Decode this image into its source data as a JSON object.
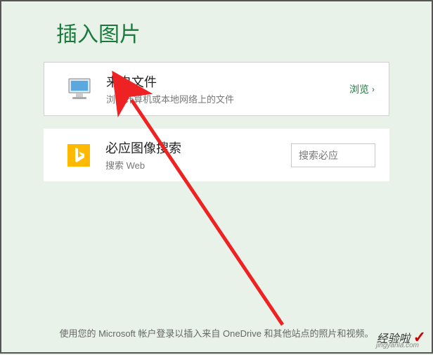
{
  "header": {
    "title": "插入图片"
  },
  "options": {
    "file": {
      "title": "来自文件",
      "desc": "浏览计算机或本地网络上的文件",
      "browse": "浏览"
    },
    "bing": {
      "title": "必应图像搜索",
      "desc": "搜索 Web",
      "placeholder": "搜索必应"
    }
  },
  "footer": {
    "text": "使用您的 Microsoft 帐户登录以插入来自 OneDrive 和其他站点的照片和视频。"
  },
  "watermark": {
    "brand": "经验啦",
    "site": "jingyanla.com"
  },
  "icons": {
    "computer": "computer-icon",
    "bing": "bing-icon",
    "chevron": "›"
  }
}
